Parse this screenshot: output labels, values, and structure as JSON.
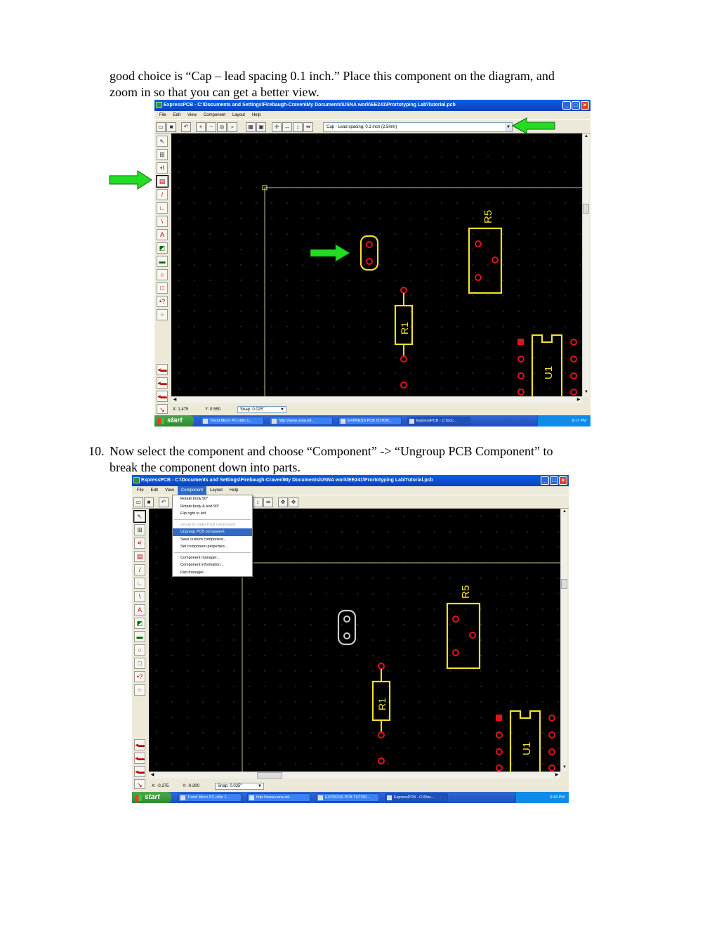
{
  "intro_text": {
    "line1": "good choice is “Cap – lead spacing 0.1 inch.”  Place this component on the diagram, and",
    "line2": "zoom in so that you can get a better view."
  },
  "step10": {
    "number": "10.",
    "line1": "Now select the component and choose “Component” -> “Ungroup PCB Component” to",
    "line2": "break the component down into parts."
  },
  "window": {
    "title": "ExpressPCB - C:\\Documents and Settings\\Firebaugh-Craven\\My Documents\\USNA work\\EE241\\Prortotyping Lab\\Tutorial.pcb",
    "menus": [
      "File",
      "Edit",
      "View",
      "Component",
      "Layout",
      "Help"
    ]
  },
  "screenshot1": {
    "component_combo": "Cap - Lead spacing: 0.1 inch (2.5mm)",
    "status": {
      "x": "X: 1.475",
      "y": "Y: 0.550",
      "snap": "Snap: 0.025\""
    },
    "taskbar": {
      "start": "start",
      "tasks": [
        "Trend Micro PC-cillin 1...",
        "http://www.usna.ed...",
        "EXPRESS PCB TUTOR...",
        "ExpressPCB - C:\\Doc..."
      ],
      "clock": "9:17 PM"
    }
  },
  "screenshot2": {
    "status": {
      "x": "X: -0.275",
      "y": "Y: -0.300",
      "snap": "Snap: 0.025\""
    },
    "taskbar": {
      "start": "start",
      "tasks": [
        "Trend Micro PC-cillin 1...",
        "http://www.usna.ed...",
        "EXPRESS PCB TUTOR...",
        "ExpressPCB - C:\\Doc..."
      ],
      "clock": "9:18 PM"
    },
    "component_menu": [
      "Rotate body 90°",
      "Rotate body & text 90°",
      "Flip right to left",
      "Group to make PCB component",
      "Ungroup PCB component",
      "Save custom component...",
      "Set component properties...",
      "Component manager...",
      "Component information...",
      "Pad manager..."
    ]
  },
  "pcb_labels": {
    "r5": "R5",
    "r1": "R1",
    "u1": "U1"
  },
  "colors": {
    "silkscreen": "#f2e02a",
    "pad": "#e0141e",
    "cap_selected": "#cccccc",
    "arrow": "#22dd22"
  },
  "icons": [
    "select-arrow-icon",
    "zoom-icon",
    "pad-icon",
    "component-icon",
    "trace-icon",
    "text-icon",
    "rectangle-icon",
    "circle-icon"
  ]
}
